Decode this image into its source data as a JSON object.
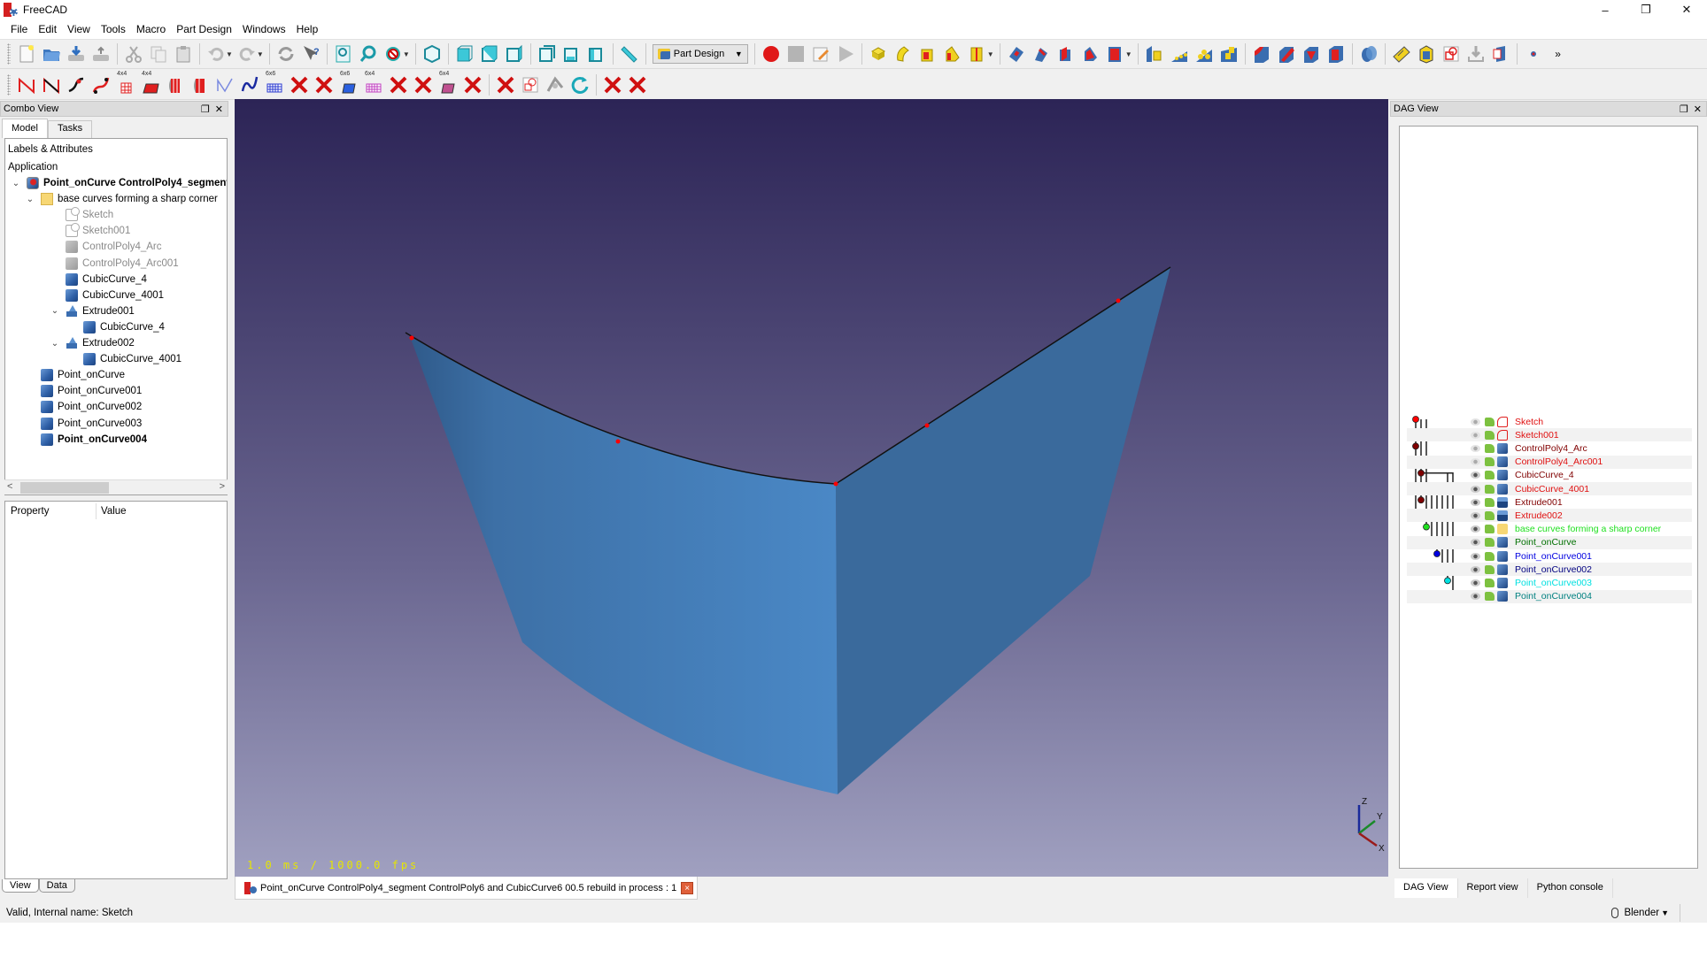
{
  "window": {
    "title": "FreeCAD",
    "controls": {
      "minimize": "–",
      "restore": "❐",
      "close": "✕"
    }
  },
  "menu": [
    {
      "label": "File",
      "key": "F"
    },
    {
      "label": "Edit",
      "key": "E"
    },
    {
      "label": "View",
      "key": "V"
    },
    {
      "label": "Tools",
      "key": "T"
    },
    {
      "label": "Macro",
      "key": "M"
    },
    {
      "label": "Part Design",
      "key": "P"
    },
    {
      "label": "Windows",
      "key": "W"
    },
    {
      "label": "Help",
      "key": "H"
    }
  ],
  "toolbar": {
    "workbench": "Part Design",
    "overflow": "»",
    "row2_labels": [
      "4x4",
      "4x4",
      "6x6",
      "6x6",
      "6x4",
      "6x4"
    ]
  },
  "combo_view": {
    "title": "Combo View",
    "tabs": [
      "Model",
      "Tasks"
    ],
    "active_tab": "Model",
    "tree_header": "Labels & Attributes",
    "tree_section": "Application",
    "tree": [
      {
        "label": "Point_onCurve ControlPoly4_segment ControlPoly6 and CubicCurve6 00.5",
        "icon": "document-icon",
        "depth": 0,
        "expanded": true,
        "style": "bold"
      },
      {
        "label": "base curves forming a sharp corner",
        "icon": "folder-icon",
        "depth": 1,
        "expanded": true,
        "style": "normal"
      },
      {
        "label": "Sketch",
        "icon": "sketch-icon",
        "depth": 2,
        "style": "grey"
      },
      {
        "label": "Sketch001",
        "icon": "sketch-icon",
        "depth": 2,
        "style": "grey"
      },
      {
        "label": "ControlPoly4_Arc",
        "icon": "part-cube-icon",
        "depth": 2,
        "style": "grey"
      },
      {
        "label": "ControlPoly4_Arc001",
        "icon": "part-cube-icon",
        "depth": 2,
        "style": "grey"
      },
      {
        "label": "CubicCurve_4",
        "icon": "part-cube-icon",
        "depth": 2,
        "style": "normal"
      },
      {
        "label": "CubicCurve_4001",
        "icon": "part-cube-icon",
        "depth": 2,
        "style": "normal"
      },
      {
        "label": "Extrude001",
        "icon": "extrude-icon",
        "depth": 2,
        "expanded": true,
        "style": "normal"
      },
      {
        "label": "CubicCurve_4",
        "icon": "part-cube-icon",
        "depth": 3,
        "style": "normal"
      },
      {
        "label": "Extrude002",
        "icon": "extrude-icon",
        "depth": 2,
        "expanded": true,
        "style": "normal"
      },
      {
        "label": "CubicCurve_4001",
        "icon": "part-cube-icon",
        "depth": 3,
        "style": "normal"
      },
      {
        "label": "Point_onCurve",
        "icon": "part-cube-icon",
        "depth": 1,
        "style": "normal"
      },
      {
        "label": "Point_onCurve001",
        "icon": "part-cube-icon",
        "depth": 1,
        "style": "normal"
      },
      {
        "label": "Point_onCurve002",
        "icon": "part-cube-icon",
        "depth": 1,
        "style": "normal"
      },
      {
        "label": "Point_onCurve003",
        "icon": "part-cube-icon",
        "depth": 1,
        "style": "normal"
      },
      {
        "label": "Point_onCurve004",
        "icon": "part-cube-icon",
        "depth": 1,
        "style": "bold"
      }
    ],
    "property_header": {
      "property": "Property",
      "value": "Value"
    },
    "bottom_tabs": [
      "View",
      "Data"
    ],
    "active_bottom_tab": "View"
  },
  "viewport": {
    "fps_text": "1.0 ms / 1000.0 fps",
    "axis_labels": {
      "x": "X",
      "y": "Y",
      "z": "Z"
    },
    "colors": {
      "surface_left": "#4684c4",
      "surface_right": "#3a6a9c",
      "edge": "#111111",
      "point": "#ff0000",
      "fps": "#e6e600"
    }
  },
  "document_tab": {
    "label": "Point_onCurve ControlPoly4_segment ControlPoly6 and CubicCurve6 00.5 rebuild in process : 1",
    "close": "×"
  },
  "dag_view": {
    "title": "DAG View",
    "rows": [
      {
        "label": "Sketch",
        "color": "#e01010",
        "icon": "sketch-icon",
        "visible": false,
        "node": "#ff0000"
      },
      {
        "label": "Sketch001",
        "color": "#e01010",
        "icon": "sketch-icon",
        "visible": false,
        "node": "#ff0000"
      },
      {
        "label": "ControlPoly4_Arc",
        "color": "#800000",
        "icon": "part-cube-icon",
        "visible": false,
        "node": "#800000"
      },
      {
        "label": "ControlPoly4_Arc001",
        "color": "#e01010",
        "icon": "part-cube-icon",
        "visible": false,
        "node": "#ff0000"
      },
      {
        "label": "CubicCurve_4",
        "color": "#800000",
        "icon": "part-cube-icon",
        "visible": true,
        "node": "#800000"
      },
      {
        "label": "CubicCurve_4001",
        "color": "#e01010",
        "icon": "part-cube-icon",
        "visible": true,
        "node": "#ff0000"
      },
      {
        "label": "Extrude001",
        "color": "#800000",
        "icon": "extrude-icon",
        "visible": true,
        "node": "#800000"
      },
      {
        "label": "Extrude002",
        "color": "#e01010",
        "icon": "extrude-icon",
        "visible": true,
        "node": "#ff0000"
      },
      {
        "label": "base curves forming a sharp corner",
        "color": "#20e020",
        "icon": "folder-icon",
        "visible": true,
        "node": "#20e020"
      },
      {
        "label": "Point_onCurve",
        "color": "#007000",
        "icon": "part-cube-icon",
        "visible": true,
        "node": "#007000"
      },
      {
        "label": "Point_onCurve001",
        "color": "#0000e0",
        "icon": "part-cube-icon",
        "visible": true,
        "node": "#0000e0"
      },
      {
        "label": "Point_onCurve002",
        "color": "#000080",
        "icon": "part-cube-icon",
        "visible": true,
        "node": "#000080"
      },
      {
        "label": "Point_onCurve003",
        "color": "#00e0e0",
        "icon": "part-cube-icon",
        "visible": true,
        "node": "#00e0e0"
      },
      {
        "label": "Point_onCurve004",
        "color": "#008080",
        "icon": "part-cube-icon",
        "visible": true,
        "node": "#008080"
      }
    ],
    "bottom_tabs": [
      "DAG View",
      "Report view",
      "Python console"
    ],
    "active_bottom_tab": "DAG View"
  },
  "statusbar": {
    "message": "Valid, Internal name: Sketch",
    "navigation_style": "Blender"
  }
}
